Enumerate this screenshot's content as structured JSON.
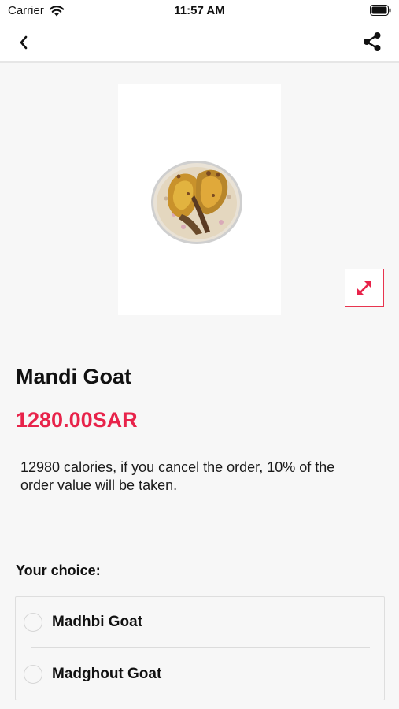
{
  "status_bar": {
    "carrier": "Carrier",
    "time": "11:57 AM",
    "icons": [
      "wifi-icon",
      "battery-icon"
    ]
  },
  "nav": {
    "back_icon": "chevron-left-icon",
    "share_icon": "share-icon"
  },
  "product": {
    "image_icon": "expand-icon",
    "title": "Mandi Goat",
    "price": "1280.00SAR",
    "description": "12980 calories, if you cancel the order, 10% of the order value will be taken."
  },
  "choices": {
    "label": "Your choice:",
    "options": [
      {
        "label": "Madhbi Goat",
        "selected": false
      },
      {
        "label": "Madghout Goat",
        "selected": false
      }
    ]
  },
  "colors": {
    "accent": "#e8234a",
    "background": "#f7f7f7"
  }
}
